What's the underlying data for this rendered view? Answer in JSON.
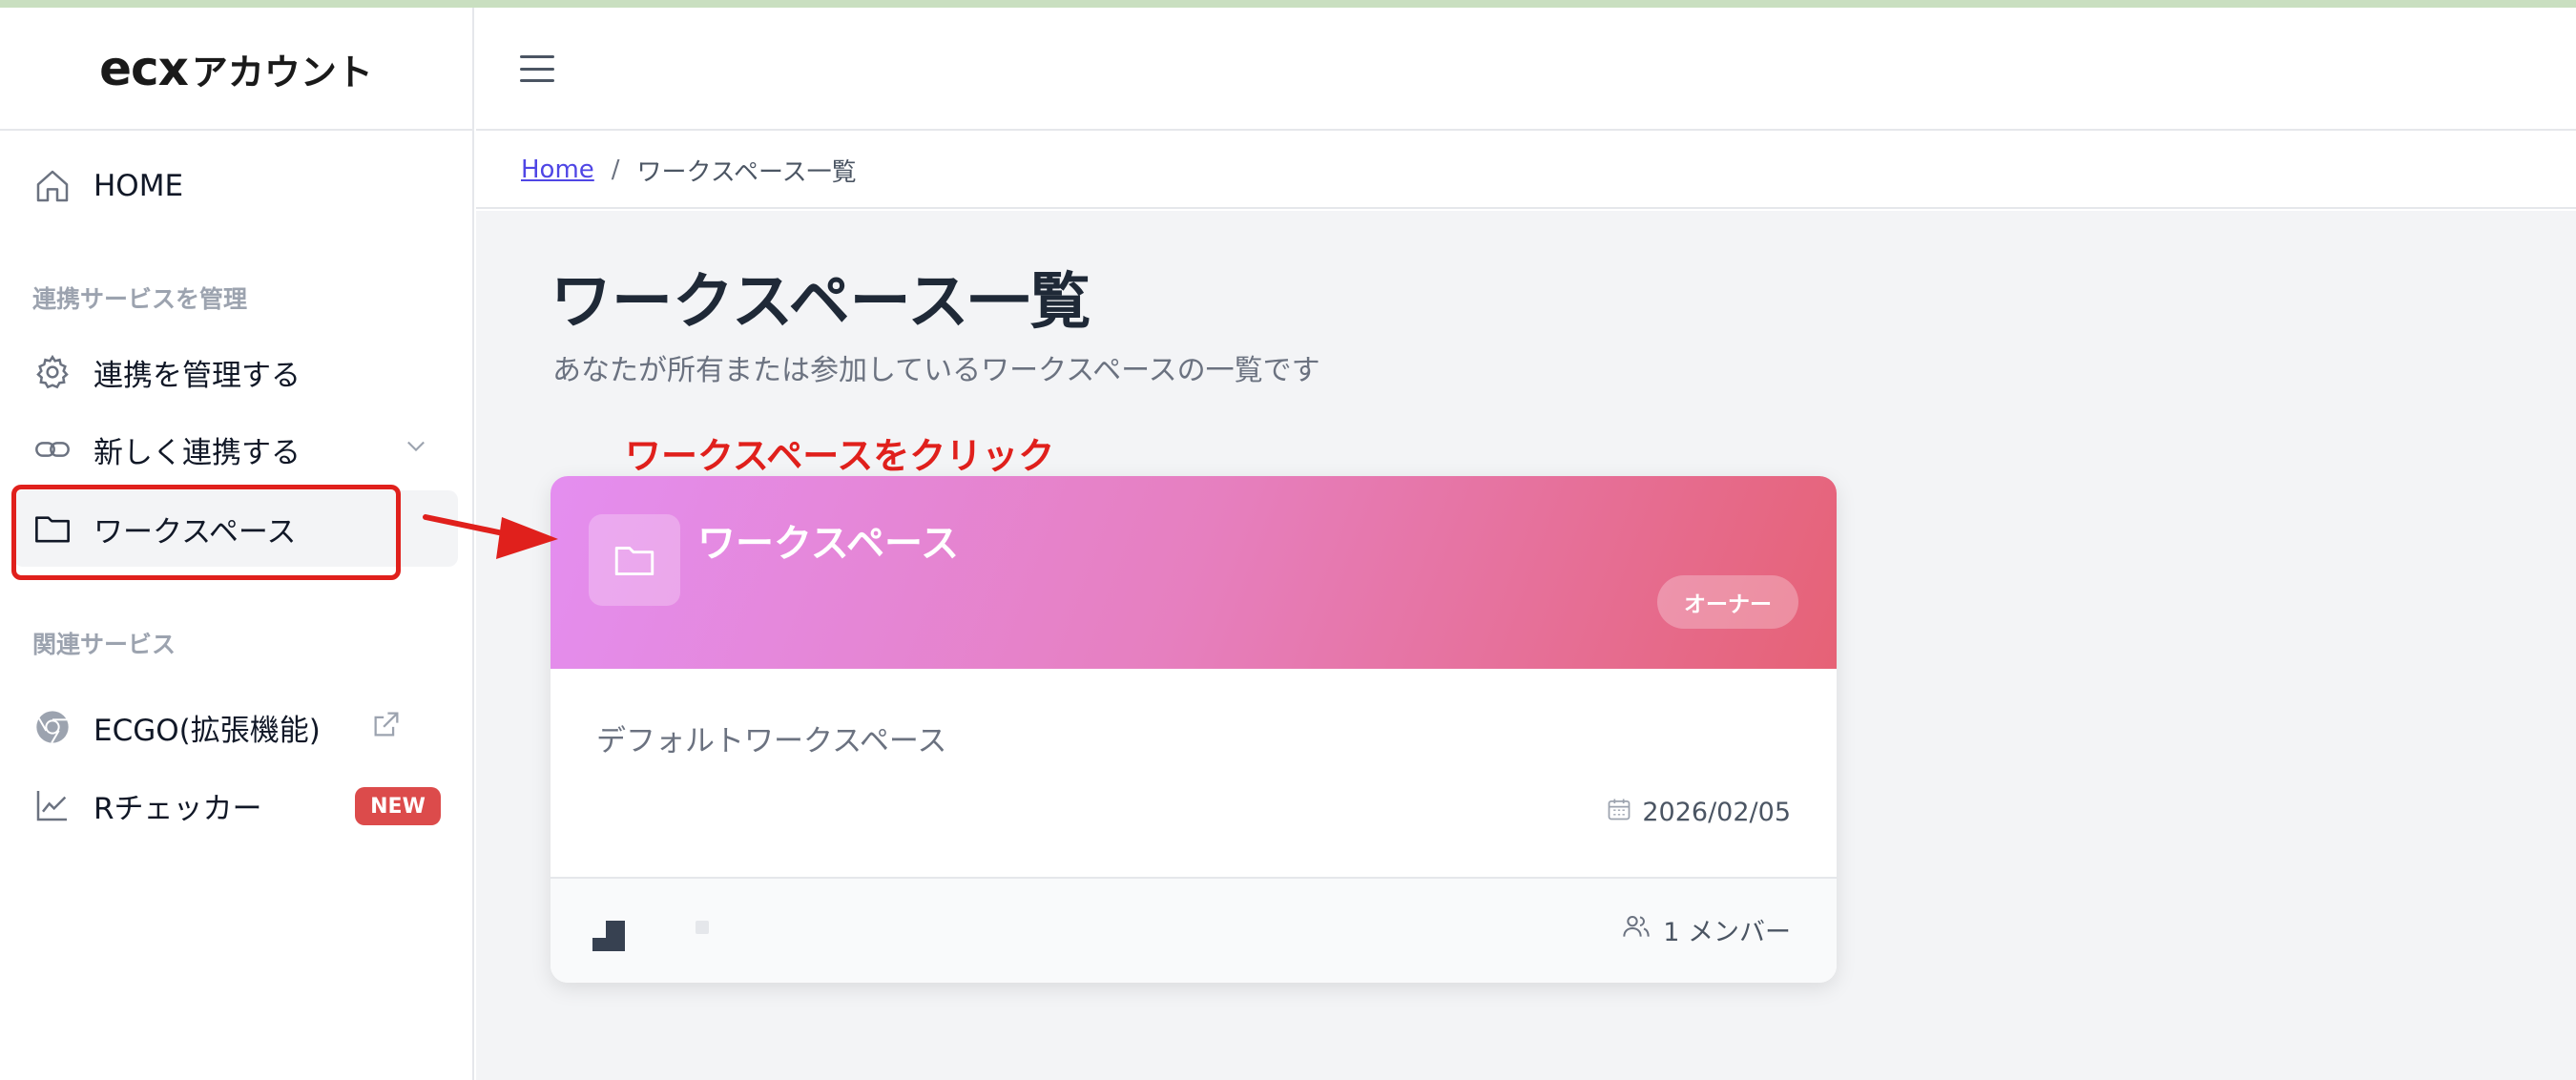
{
  "app": {
    "logo_mark": "ecx",
    "logo_text": "アカウント"
  },
  "sidebar": {
    "items": [
      {
        "label": "HOME",
        "icon": "home-icon"
      },
      {
        "label": "連携を管理する",
        "icon": "gear-icon"
      },
      {
        "label": "新しく連携する",
        "icon": "link-icon"
      },
      {
        "label": "ワークスペース",
        "icon": "folder-icon",
        "active": true
      },
      {
        "label": "ECGO(拡張機能)",
        "icon": "chrome-icon"
      },
      {
        "label": "Rチェッカー",
        "icon": "chart-line-icon",
        "badge": "NEW"
      }
    ],
    "sections": {
      "manage": "連携サービスを管理",
      "related": "関連サービス"
    }
  },
  "breadcrumb": {
    "home": "Home",
    "separator": "/",
    "current": "ワークスペース一覧"
  },
  "main": {
    "title": "ワークスペース一覧",
    "subtitle": "あなたが所有または参加しているワークスペースの一覧です",
    "annotation": "ワークスペースをクリック"
  },
  "workspace_card": {
    "name": "ワークスペース",
    "role_badge": "オーナー",
    "description": "デフォルトワークスペース",
    "date": "2026/02/05",
    "members": "1 メンバー",
    "gradient": [
      "#e48ef0",
      "#e66276"
    ]
  },
  "colors": {
    "annotation_red": "#e0201c",
    "link": "#4f46e5",
    "new_badge": "#dc4b4b"
  }
}
